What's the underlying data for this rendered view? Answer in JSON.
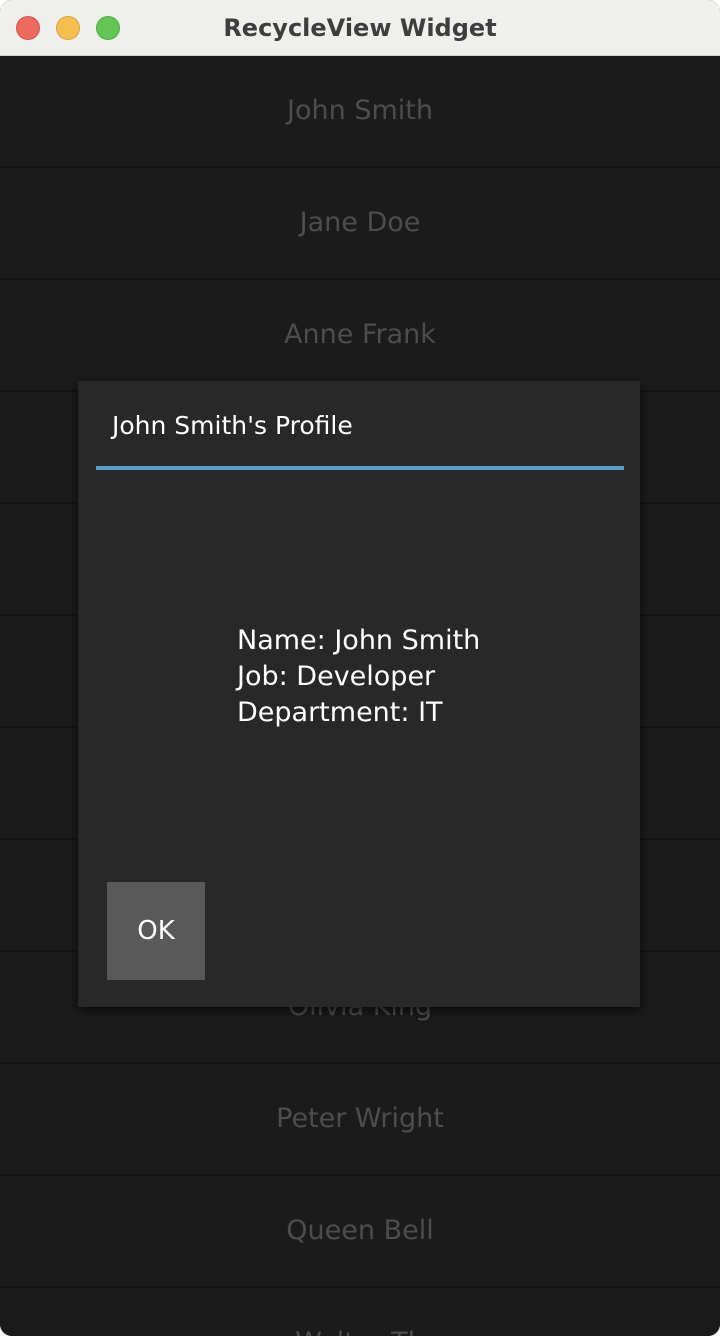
{
  "window": {
    "title": "RecycleView Widget"
  },
  "list": {
    "items": [
      {
        "label": "John Smith"
      },
      {
        "label": "Jane Doe"
      },
      {
        "label": "Anne Frank"
      },
      {
        "label": ""
      },
      {
        "label": ""
      },
      {
        "label": ""
      },
      {
        "label": ""
      },
      {
        "label": ""
      },
      {
        "label": "Olivia King"
      },
      {
        "label": "Peter Wright"
      },
      {
        "label": "Queen Bell"
      },
      {
        "label": "Walter Th"
      }
    ]
  },
  "dialog": {
    "title": "John Smith's Profile",
    "lines": [
      "Name: John Smith",
      "Job: Developer",
      "Department: IT"
    ],
    "ok_label": "OK"
  },
  "colors": {
    "accent": "#5b9bc8",
    "list_background": "#1b1b1b",
    "dialog_background": "#282828",
    "button_background": "#595959"
  }
}
